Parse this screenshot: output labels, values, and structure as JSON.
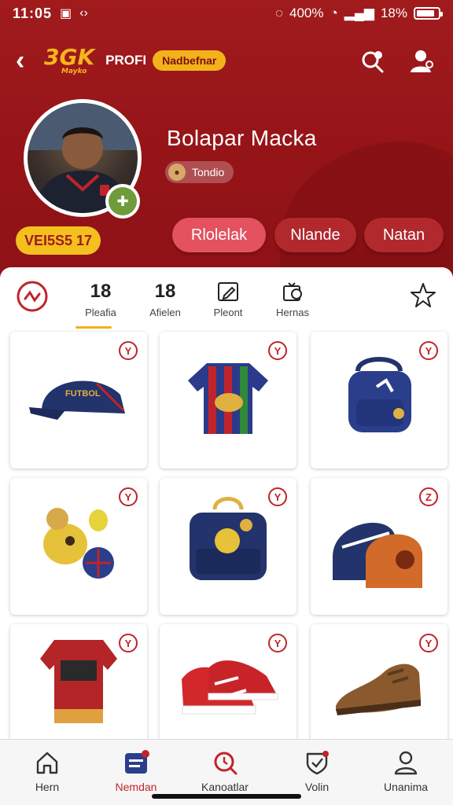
{
  "status_bar": {
    "time": "11:05",
    "right_text_1": "400%",
    "right_text_2": "18%"
  },
  "topbar": {
    "logo": "3GK",
    "logo_sub": "Mayko",
    "profile_label": "PROFI",
    "pill": "Nadbefnar"
  },
  "profile": {
    "name": "Bolapar Macka",
    "tag": "Tondio",
    "level_badge": "VEI5S5 17"
  },
  "actions": {
    "primary": "Rlolelak",
    "secondary": "Nlande",
    "tertiary": "Natan"
  },
  "stats": [
    {
      "num": "18",
      "label": "Pleafia"
    },
    {
      "num": "18",
      "label": "Afielen"
    },
    {
      "num": "",
      "label": "Pleont"
    },
    {
      "num": "",
      "label": "Hernas"
    }
  ],
  "grid_items": [
    {
      "icon": "cap-icon",
      "corner": "Y"
    },
    {
      "icon": "jersey-icon",
      "corner": "Y"
    },
    {
      "icon": "backpack-icon",
      "corner": "Y"
    },
    {
      "icon": "toy-icon",
      "corner": "Y"
    },
    {
      "icon": "bag-icon",
      "corner": "Y"
    },
    {
      "icon": "duffel-icon",
      "corner": "Z"
    },
    {
      "icon": "shirt-icon",
      "corner": "Y"
    },
    {
      "icon": "sneakers-icon",
      "corner": "Y"
    },
    {
      "icon": "shoe-icon",
      "corner": "Y"
    }
  ],
  "nav": [
    {
      "label": "Hern",
      "icon": "home-icon"
    },
    {
      "label": "Nemdan",
      "icon": "list-icon"
    },
    {
      "label": "Kanoatlar",
      "icon": "search-icon"
    },
    {
      "label": "Volin",
      "icon": "shield-icon"
    },
    {
      "label": "Unanima",
      "icon": "user-icon"
    }
  ],
  "colors": {
    "brand": "#a11b1d",
    "accent": "#f3b21a",
    "active_nav": "#c0242a"
  }
}
